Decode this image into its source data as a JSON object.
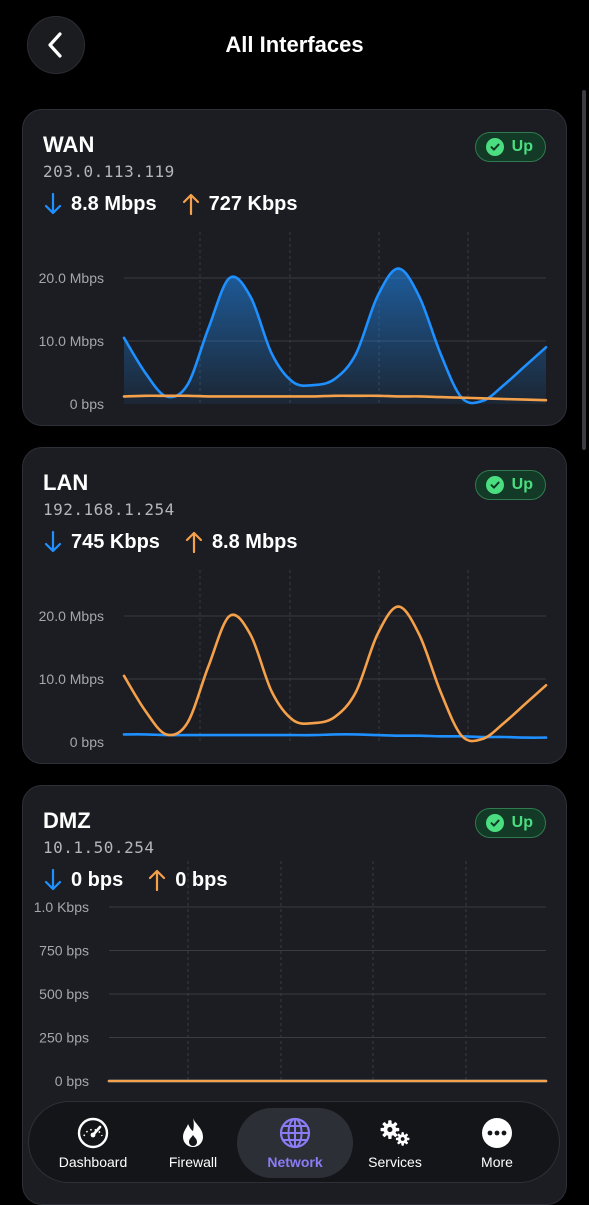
{
  "header": {
    "title": "All Interfaces",
    "back_icon": "chevron-left-icon"
  },
  "interfaces": [
    {
      "name": "WAN",
      "ip": "203.0.113.119",
      "status": "Up",
      "download": "8.8 Mbps",
      "upload": "727 Kbps",
      "chart": {
        "y_ticks": [
          "20.0 Mbps",
          "10.0 Mbps",
          "0 bps"
        ],
        "fill_series": "download"
      }
    },
    {
      "name": "LAN",
      "ip": "192.168.1.254",
      "status": "Up",
      "download": "745 Kbps",
      "upload": "8.8 Mbps",
      "chart": {
        "y_ticks": [
          "20.0 Mbps",
          "10.0 Mbps",
          "0 bps"
        ],
        "fill_series": "none"
      }
    },
    {
      "name": "DMZ",
      "ip": "10.1.50.254",
      "status": "Up",
      "download": "0 bps",
      "upload": "0 bps",
      "chart": {
        "y_ticks": [
          "1.0 Kbps",
          "750 bps",
          "500 bps",
          "250 bps",
          "0 bps"
        ],
        "fill_series": "none"
      }
    }
  ],
  "chart_data": [
    {
      "type": "line",
      "ylim": [
        0,
        20
      ],
      "x": [
        0,
        1,
        2,
        3,
        4,
        5,
        6,
        7,
        8,
        9,
        10,
        11,
        12,
        13,
        14,
        15,
        16,
        17,
        18,
        19,
        20
      ],
      "series": [
        {
          "values": [
            10.5,
            5,
            1.2,
            3,
            12,
            20,
            17,
            8,
            3.5,
            3,
            4,
            8,
            17,
            21.5,
            17,
            8,
            1,
            0.5,
            3,
            6,
            9
          ]
        },
        {
          "values": [
            1.2,
            1.3,
            1.3,
            1.3,
            1.2,
            1.2,
            1.2,
            1.2,
            1.2,
            1.2,
            1.3,
            1.3,
            1.3,
            1.2,
            1.2,
            1.1,
            1,
            0.9,
            0.8,
            0.7,
            0.6
          ]
        }
      ],
      "colors": [
        "#1e90ff",
        "#f5a04a"
      ]
    },
    {
      "type": "line",
      "ylim": [
        0,
        20
      ],
      "x": [
        0,
        1,
        2,
        3,
        4,
        5,
        6,
        7,
        8,
        9,
        10,
        11,
        12,
        13,
        14,
        15,
        16,
        17,
        18,
        19,
        20
      ],
      "series": [
        {
          "values": [
            1.2,
            1.2,
            1.1,
            1.1,
            1.1,
            1.1,
            1.1,
            1.1,
            1.1,
            1.1,
            1.2,
            1.2,
            1.1,
            1.0,
            1.0,
            0.9,
            0.9,
            0.8,
            0.8,
            0.7,
            0.7
          ]
        },
        {
          "values": [
            10.5,
            5,
            1.2,
            3,
            12,
            20,
            17,
            8,
            3.5,
            3,
            4,
            8,
            17,
            21.5,
            17,
            8,
            1,
            0.5,
            3,
            6,
            9
          ]
        }
      ],
      "colors": [
        "#1e90ff",
        "#f5a04a"
      ]
    },
    {
      "type": "line",
      "ylim": [
        0,
        1000
      ],
      "x": [
        0,
        1,
        2,
        3,
        4,
        5,
        6,
        7,
        8,
        9,
        10
      ],
      "series": [
        {
          "values": [
            0,
            0,
            0,
            0,
            0,
            0,
            0,
            0,
            0,
            0,
            0
          ]
        },
        {
          "values": [
            0,
            0,
            0,
            0,
            0,
            0,
            0,
            0,
            0,
            0,
            0
          ]
        }
      ],
      "colors": [
        "#1e90ff",
        "#f5a04a"
      ]
    }
  ],
  "tabs": [
    {
      "label": "Dashboard",
      "icon": "gauge-icon",
      "active": false
    },
    {
      "label": "Firewall",
      "icon": "flame-icon",
      "active": false
    },
    {
      "label": "Network",
      "icon": "globe-icon",
      "active": true
    },
    {
      "label": "Services",
      "icon": "gears-icon",
      "active": false
    },
    {
      "label": "More",
      "icon": "ellipsis-icon",
      "active": false
    }
  ],
  "colors": {
    "download": "#1e90ff",
    "upload": "#f5a04a",
    "status_up": "#4ade80",
    "active_tab": "#8b7cf6"
  }
}
